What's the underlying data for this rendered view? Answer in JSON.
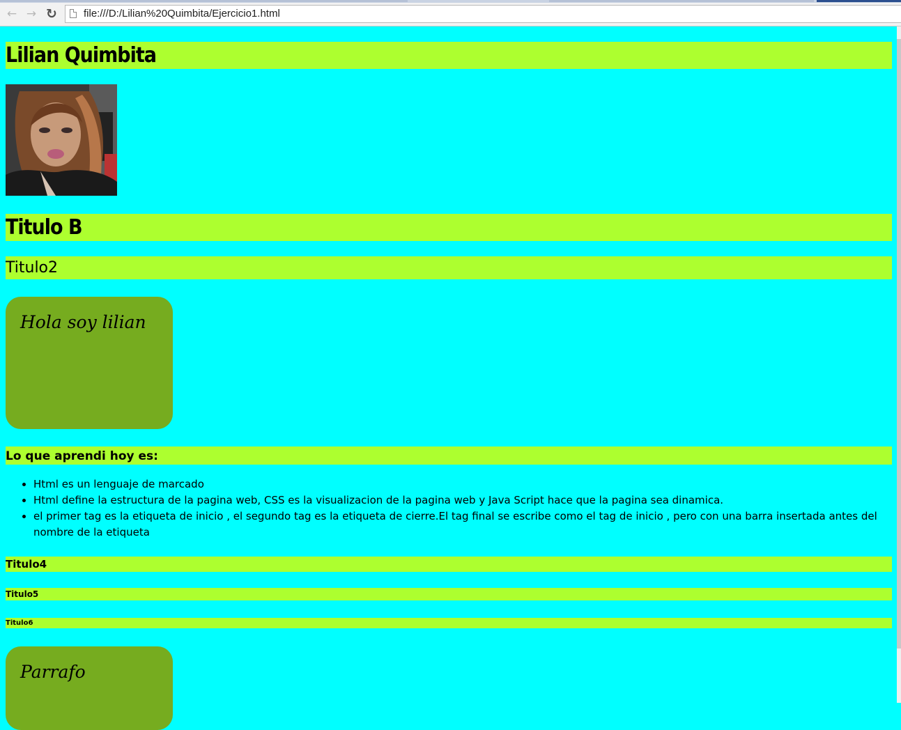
{
  "browser": {
    "url": "file:///D:/Lilian%20Quimbita/Ejercicio1.html",
    "back_icon": "arrow-left-icon",
    "forward_icon": "arrow-right-icon",
    "reload_icon": "reload-icon",
    "page_icon": "document-icon"
  },
  "page": {
    "background_color": "#00ffff",
    "heading_bg_color": "#adff2f",
    "card_color": "#76ac1f",
    "h1": "Lilian Quimbita",
    "photo_alt": "profile-photo",
    "titulo_b": "Titulo B",
    "titulo2": "Titulo2",
    "card1_text": "Hola soy lilian",
    "h3": "Lo que aprendi hoy es:",
    "list": [
      "Html es un lenguaje de marcado",
      "Html define la estructura de la pagina web, CSS es la visualizacion de la pagina web y Java Script hace que la pagina sea dinamica.",
      "el primer tag es la etiqueta de inicio , el segundo tag es la etiqueta de cierre.El tag final se escribe como el tag de inicio , pero con una barra insertada antes del nombre de la etiqueta"
    ],
    "titulo4": "Titulo4",
    "titulo5": "Titulo5",
    "titulo6": "Titulo6",
    "card2_text": "Parrafo"
  }
}
